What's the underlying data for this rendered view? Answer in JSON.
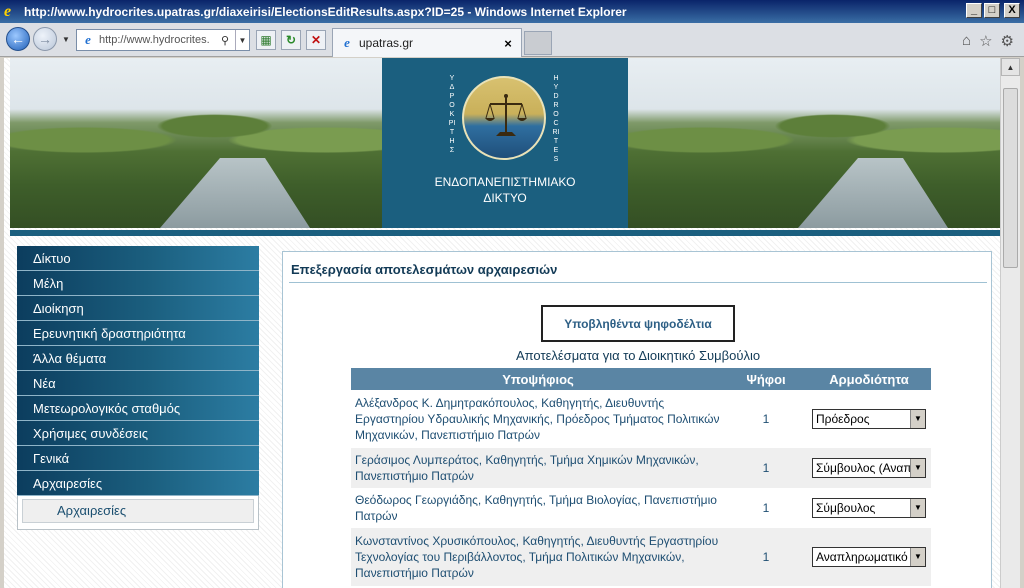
{
  "window": {
    "title": "http://www.hydrocrites.upatras.gr/diaxeirisi/ElectionsEditResults.aspx?ID=25 - Windows Internet Explorer",
    "minimize": "_",
    "maximize": "□",
    "close": "X"
  },
  "nav": {
    "address": "http://www.hydrocrites.",
    "tab_label": "upatras.gr",
    "tab_close": "×"
  },
  "banner": {
    "vertical_left": "ΥΔΡΟΚΡΙΤΗΣ",
    "vertical_right": "HYDROCRITES",
    "title_line1": "ΕΝΔΟΠΑΝΕΠΙΣΤΗΜΙΑΚΟ",
    "title_line2": "ΔΙΚΤΥΟ"
  },
  "sidebar": {
    "items": [
      {
        "label": "Δίκτυο"
      },
      {
        "label": "Μέλη"
      },
      {
        "label": "Διοίκηση"
      },
      {
        "label": "Ερευνητική δραστηριότητα"
      },
      {
        "label": "Άλλα θέματα"
      },
      {
        "label": "Νέα"
      },
      {
        "label": "Μετεωρολογικός σταθμός"
      },
      {
        "label": "Χρήσιμες συνδέσεις"
      },
      {
        "label": "Γενικά"
      },
      {
        "label": "Αρχαιρεσίες"
      }
    ],
    "submenu": [
      {
        "label": "Αρχαιρεσίες"
      }
    ]
  },
  "content": {
    "title": "Επεξεργασία αποτελεσμάτων αρχαιρεσιών",
    "ballots_button": "Υποβληθέντα ψηφοδέλτια",
    "results_caption": "Αποτελέσματα για το Διοικητικό Συμβούλιο",
    "table": {
      "headers": [
        "Υποψήφιος",
        "Ψήφοι",
        "Αρμοδιότητα"
      ],
      "rows": [
        {
          "name": "Αλέξανδρος Κ. Δημητρακόπουλος",
          "details": ", Καθηγητής, Διευθυντής Εργαστηρίου Υδραυλικής Μηχανικής,  Πρόεδρος Τμήματος Πολιτικών Μηχανικών,  Πανεπιστήμιο Πατρών",
          "votes": "1",
          "role": "Πρόεδρος"
        },
        {
          "name": "Γεράσιμος Λυμπεράτος",
          "details": ", Καθηγητής, Τμήμα Χημικών Μηχανικών, Πανεπιστήμιο Πατρών",
          "votes": "1",
          "role": "Σύμβουλος (Αναπλ"
        },
        {
          "name": "Θεόδωρος Γεωργιάδης",
          "details": ", Καθηγητής, Τμήμα Βιολογίας, Πανεπιστήμιο Πατρών",
          "votes": "1",
          "role": "Σύμβουλος"
        },
        {
          "name": "Κωνσταντίνος Χρυσικόπουλος",
          "details": ", Καθηγητής, Διευθυντής Εργαστηρίου Τεχνολογίας του Περιβάλλοντος, Τμήμα Πολιτικών Μηχανικών, Πανεπιστήμιο Πατρών",
          "votes": "1",
          "role": "Αναπληρωματικό"
        }
      ]
    }
  }
}
